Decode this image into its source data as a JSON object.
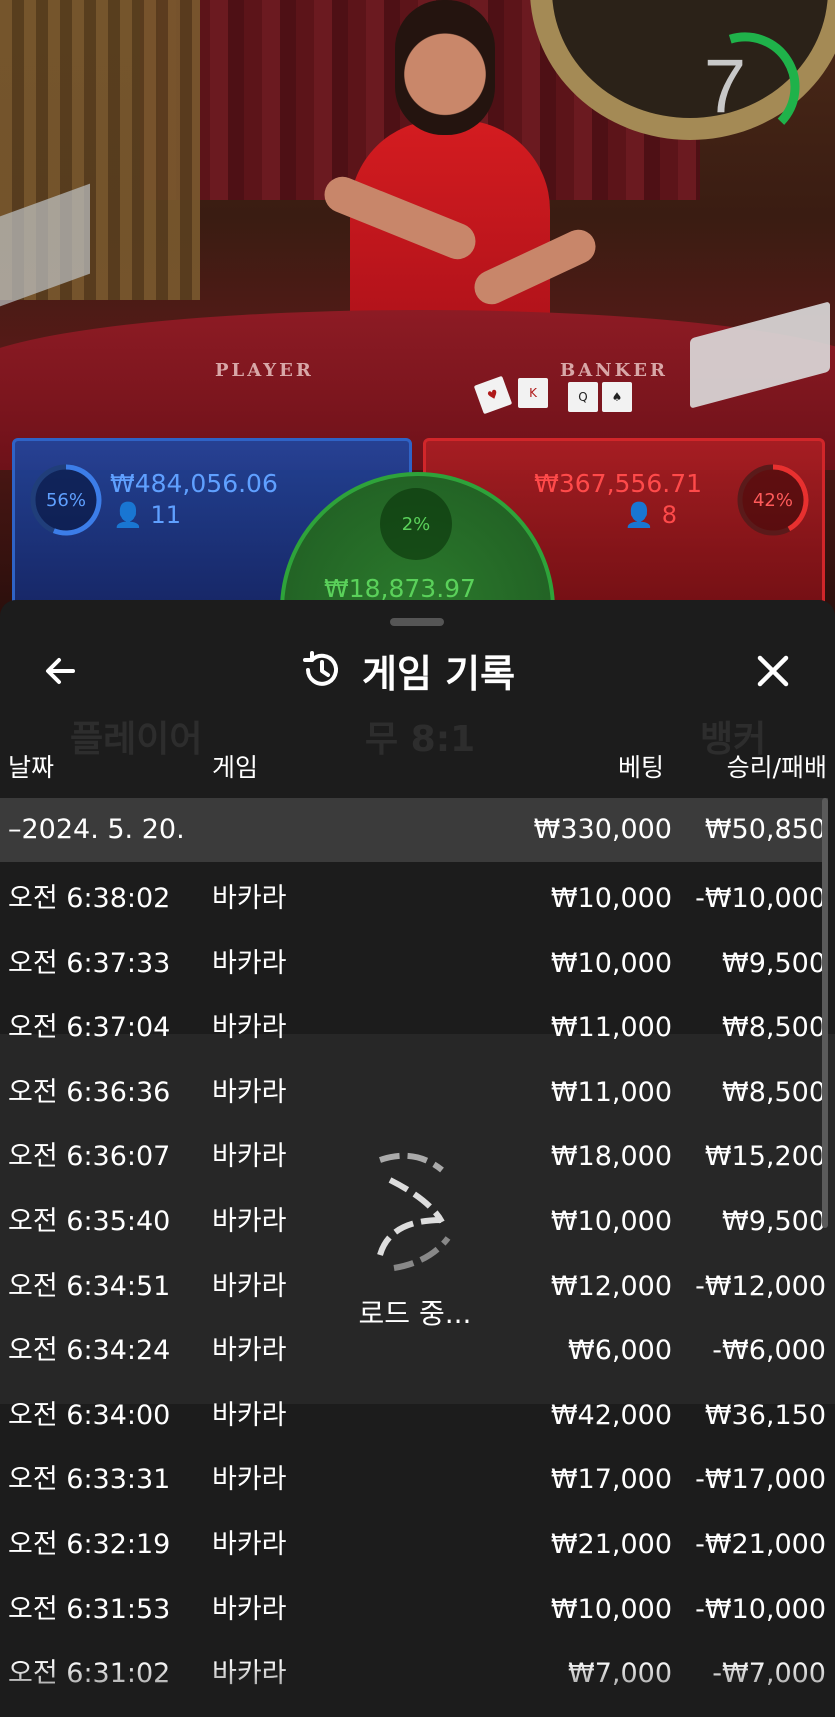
{
  "timer": {
    "value": "7",
    "progress": 0.7
  },
  "bets": {
    "player": {
      "percent": "56%",
      "amount": "₩484,056.06",
      "players": "11"
    },
    "tie": {
      "percent": "2%",
      "amount": "₩18,873.97"
    },
    "banker": {
      "percent": "42%",
      "amount": "₩367,556.71",
      "players": "8"
    }
  },
  "table_labels": {
    "player": "PLAYER",
    "banker": "BANKER"
  },
  "history": {
    "title": "게임 기록",
    "columns": {
      "date": "날짜",
      "game": "게임",
      "bet": "베팅",
      "winloss": "승리/패배"
    },
    "summary": {
      "date": "–2024. 5. 20.",
      "bet": "₩330,000",
      "winloss": "₩50,850"
    },
    "rows": [
      {
        "time": "오전 6:38:02",
        "game": "바카라",
        "bet": "₩10,000",
        "winloss": "-₩10,000"
      },
      {
        "time": "오전 6:37:33",
        "game": "바카라",
        "bet": "₩10,000",
        "winloss": "₩9,500"
      },
      {
        "time": "오전 6:37:04",
        "game": "바카라",
        "bet": "₩11,000",
        "winloss": "₩8,500"
      },
      {
        "time": "오전 6:36:36",
        "game": "바카라",
        "bet": "₩11,000",
        "winloss": "₩8,500"
      },
      {
        "time": "오전 6:36:07",
        "game": "바카라",
        "bet": "₩18,000",
        "winloss": "₩15,200"
      },
      {
        "time": "오전 6:35:40",
        "game": "바카라",
        "bet": "₩10,000",
        "winloss": "₩9,500"
      },
      {
        "time": "오전 6:34:51",
        "game": "바카라",
        "bet": "₩12,000",
        "winloss": "-₩12,000"
      },
      {
        "time": "오전 6:34:24",
        "game": "바카라",
        "bet": "₩6,000",
        "winloss": "-₩6,000"
      },
      {
        "time": "오전 6:34:00",
        "game": "바카라",
        "bet": "₩42,000",
        "winloss": "₩36,150"
      },
      {
        "time": "오전 6:33:31",
        "game": "바카라",
        "bet": "₩17,000",
        "winloss": "-₩17,000"
      },
      {
        "time": "오전 6:32:19",
        "game": "바카라",
        "bet": "₩21,000",
        "winloss": "-₩21,000"
      },
      {
        "time": "오전 6:31:53",
        "game": "바카라",
        "bet": "₩10,000",
        "winloss": "-₩10,000"
      },
      {
        "time": "오전 6:31:02",
        "game": "바카라",
        "bet": "₩7,000",
        "winloss": "-₩7,000"
      }
    ],
    "loading_text": "로드 중..."
  },
  "background_ghost": {
    "player": "플레이어",
    "tie": "무 8:1",
    "banker": "뱅커"
  },
  "colors": {
    "player": "#2f63c6",
    "banker": "#d1262a",
    "tie": "#2ea33a",
    "sheet": "#1c1c1c"
  },
  "icons": {
    "back": "arrow-left-icon",
    "history": "history-clock-icon",
    "close": "close-icon",
    "loader": "spinner-icon",
    "player_count": "person-icon"
  }
}
